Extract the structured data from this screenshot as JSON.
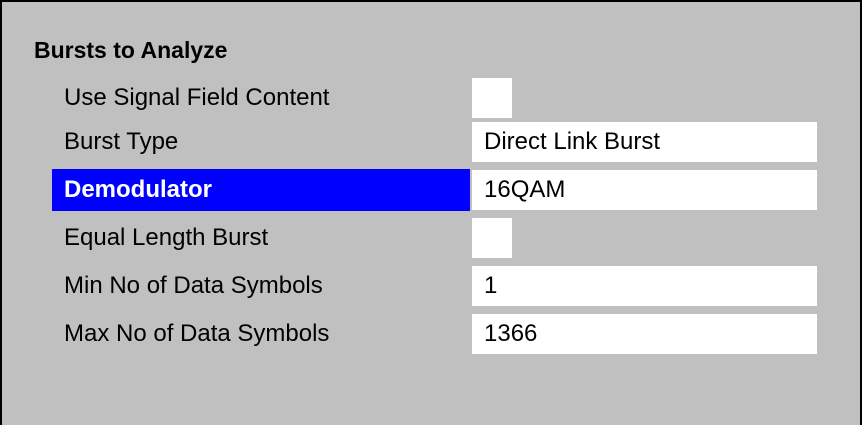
{
  "colors": {
    "panel_background": "#c0c0c0",
    "selection_background": "#0000ff",
    "selection_text": "#ffffff",
    "field_background": "#ffffff"
  },
  "group": {
    "title": "Bursts to Analyze"
  },
  "rows": [
    {
      "label": "Use Signal Field Content",
      "type": "checkbox",
      "checked": false
    },
    {
      "label": "Burst Type",
      "type": "field",
      "value": "Direct Link Burst"
    },
    {
      "label": "Demodulator",
      "type": "field",
      "value": "16QAM",
      "selected": true
    },
    {
      "label": "Equal Length Burst",
      "type": "checkbox",
      "checked": false
    },
    {
      "label": "Min No of Data Symbols",
      "type": "field",
      "value": "1"
    },
    {
      "label": "Max No of Data Symbols",
      "type": "field",
      "value": "1366"
    }
  ]
}
